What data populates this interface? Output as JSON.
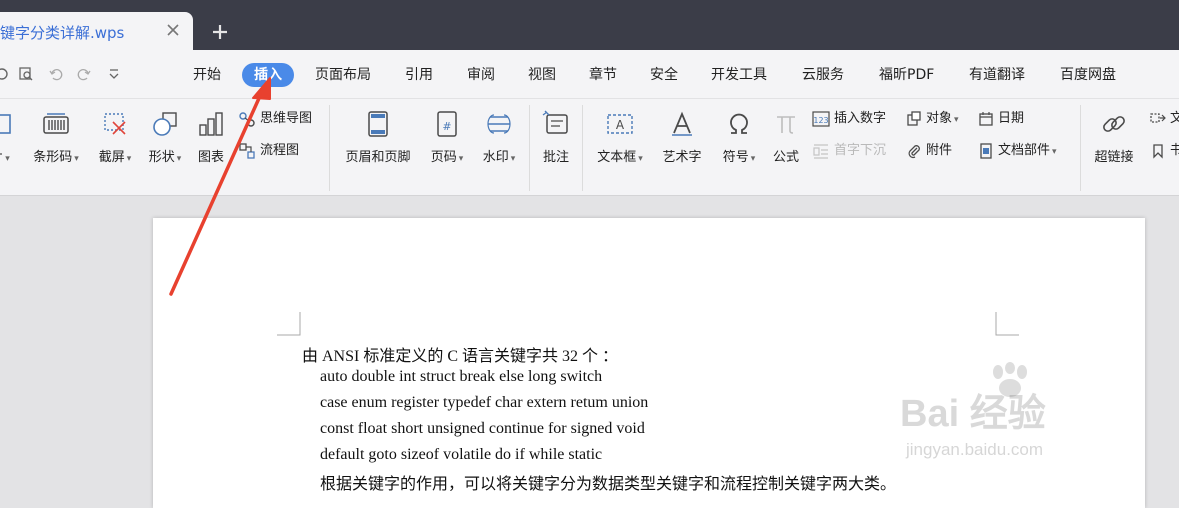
{
  "window": {
    "tab_title": "键字分类详解.wps",
    "close_icon": "close-icon",
    "new_tab_icon": "plus-icon"
  },
  "quick_access": [
    "print-preview-icon",
    "zoom-icon",
    "undo-icon",
    "redo-icon",
    "customize-dropdown-icon"
  ],
  "menu": {
    "items": [
      "开始",
      "插入",
      "页面布局",
      "引用",
      "审阅",
      "视图",
      "章节",
      "安全",
      "开发工具",
      "云服务",
      "福昕PDF",
      "有道翻译",
      "百度网盘"
    ],
    "active": "插入",
    "accent": "#4a8ae8"
  },
  "ribbon": {
    "picture_label_partial": "片",
    "barcode": "条形码",
    "screenshot": "截屏",
    "shapes": "形状",
    "chart": "图表",
    "mindmap": "思维导图",
    "flowchart": "流程图",
    "header_footer": "页眉和页脚",
    "page_number": "页码",
    "watermark": "水印",
    "comment": "批注",
    "textbox": "文本框",
    "wordart": "艺术字",
    "symbol": "符号",
    "formula": "公式",
    "insert_number": "插入数字",
    "dropcap": "首字下沉",
    "object": "对象",
    "attachment": "附件",
    "date": "日期",
    "doc_parts": "文档部件",
    "hyperlink": "超链接",
    "partial_1": "文",
    "partial_2": "书"
  },
  "document": {
    "lines": [
      "由 ANSI 标准定义的 C 语言关键字共 32 个 ：",
      "auto double int struct break else long switch",
      "case enum register typedef char extern retum union",
      "const float short unsigned continue for signed void",
      "default goto sizeof volatile do if while static",
      "根据关键字的作用，可以将关键字分为数据类型关键字和流程控制关键字两大类。"
    ]
  },
  "watermark": {
    "main": "Bai 经验",
    "sub": "jingyan.baidu.com"
  },
  "annotation": {
    "arrow_color": "#e8412f"
  }
}
